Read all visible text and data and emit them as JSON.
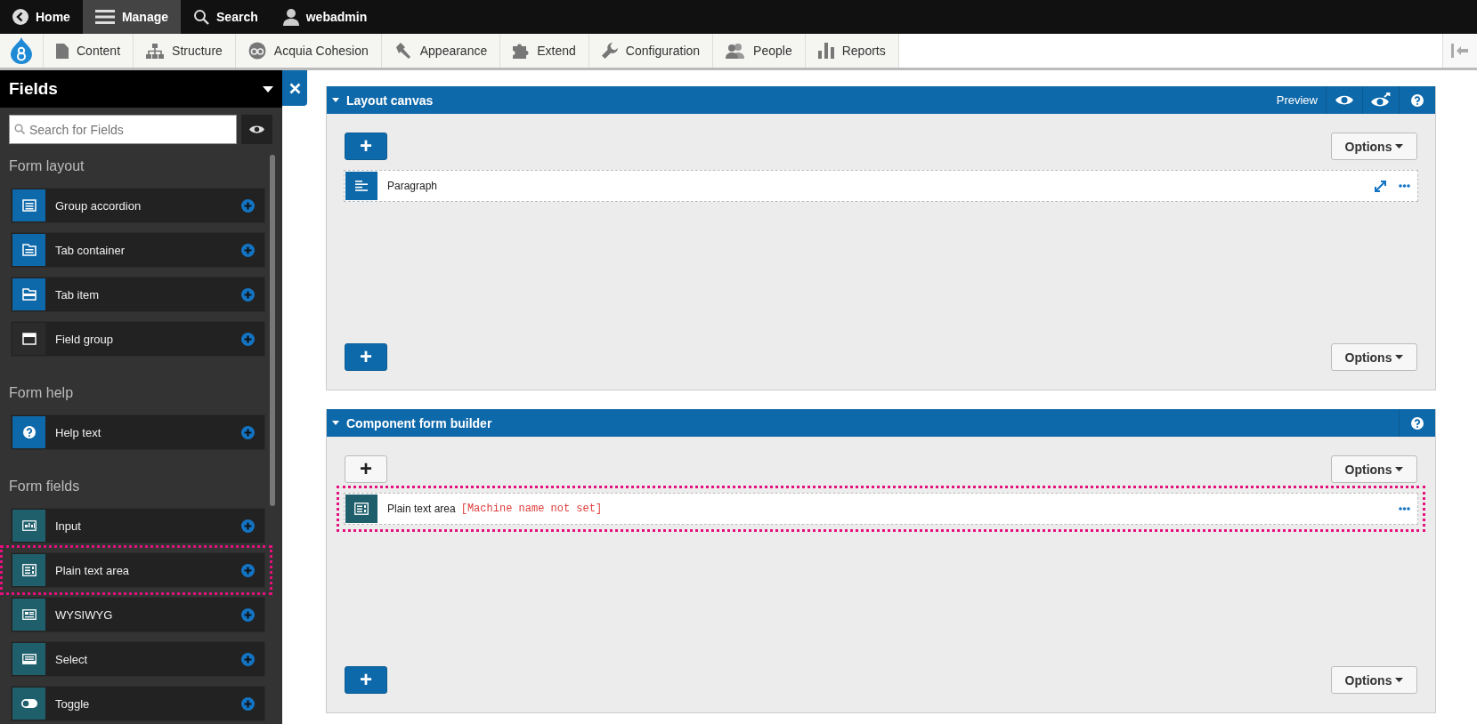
{
  "toolbar": {
    "items": [
      {
        "label": "Home",
        "selected": false
      },
      {
        "label": "Manage",
        "selected": true
      },
      {
        "label": "Search",
        "selected": false
      },
      {
        "label": "webadmin",
        "selected": false
      }
    ]
  },
  "admin_menu": {
    "items": [
      {
        "label": "Content"
      },
      {
        "label": "Structure"
      },
      {
        "label": "Acquia Cohesion"
      },
      {
        "label": "Appearance"
      },
      {
        "label": "Extend"
      },
      {
        "label": "Configuration"
      },
      {
        "label": "People"
      },
      {
        "label": "Reports"
      }
    ]
  },
  "sidebar": {
    "title": "Fields",
    "search": {
      "placeholder": "Search for Fields"
    },
    "sections": [
      {
        "title": "Form layout",
        "items": [
          {
            "label": "Group accordion",
            "color": "#0e69aa",
            "highlighted": false
          },
          {
            "label": "Tab container",
            "color": "#0e69aa",
            "highlighted": false
          },
          {
            "label": "Tab item",
            "color": "#0e69aa",
            "highlighted": false
          },
          {
            "label": "Field group",
            "color": "#2b2b2b",
            "highlighted": false
          }
        ]
      },
      {
        "title": "Form help",
        "items": [
          {
            "label": "Help text",
            "color": "#0e69aa",
            "highlighted": false
          }
        ]
      },
      {
        "title": "Form fields",
        "items": [
          {
            "label": "Input",
            "color": "#1f5f6c",
            "highlighted": false
          },
          {
            "label": "Plain text area",
            "color": "#1f5f6c",
            "highlighted": true
          },
          {
            "label": "WYSIWYG",
            "color": "#1f5f6c",
            "highlighted": false
          },
          {
            "label": "Select",
            "color": "#1f5f6c",
            "highlighted": false
          },
          {
            "label": "Toggle",
            "color": "#1f5f6c",
            "highlighted": false
          }
        ]
      }
    ]
  },
  "panels": [
    {
      "title": "Layout canvas",
      "preview_label": "Preview",
      "top_add": {
        "label": "+",
        "primary": true
      },
      "bottom_add": {
        "label": "+",
        "primary": true
      },
      "top_options_label": "Options",
      "bottom_options_label": "Options",
      "rows": [
        {
          "label": "Paragraph",
          "color": "#0e69aa",
          "highlighted": false,
          "expandable": true
        }
      ]
    },
    {
      "title": "Component form builder",
      "top_add": {
        "label": "+",
        "primary": false
      },
      "bottom_add": {
        "label": "+",
        "primary": true
      },
      "top_options_label": "Options",
      "bottom_options_label": "Options",
      "rows": [
        {
          "label": "Plain text area",
          "machine_name": "[Machine name not set]",
          "color": "#1f5f6c",
          "highlighted": true,
          "expandable": false
        }
      ]
    }
  ]
}
